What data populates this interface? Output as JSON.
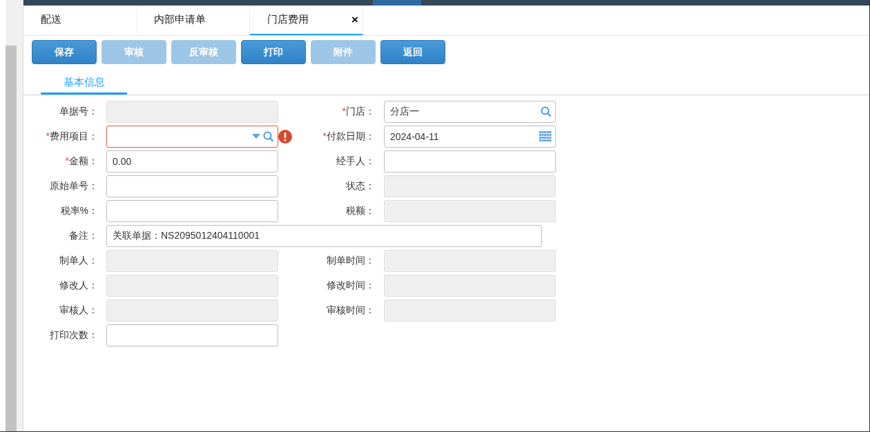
{
  "tabs": [
    {
      "label": "配送",
      "selected": false
    },
    {
      "label": "内部申请单",
      "selected": false
    },
    {
      "label": "门店费用",
      "selected": true,
      "close": "×"
    }
  ],
  "toolbar": [
    {
      "label": "保存",
      "disabled": false
    },
    {
      "label": "审核",
      "disabled": true
    },
    {
      "label": "反审核",
      "disabled": true
    },
    {
      "label": "打印",
      "disabled": false
    },
    {
      "label": "附件",
      "disabled": true
    },
    {
      "label": "返回",
      "disabled": false
    }
  ],
  "section_tabs": [
    {
      "label": "基本信息",
      "selected": true
    }
  ],
  "form_rows": [
    {
      "fields": [
        {
          "label": "单据号：",
          "kind": "text",
          "disabled": true
        },
        {
          "label": "门店：",
          "required": "*",
          "kind": "lookup",
          "disabled": false,
          "value": "分店一"
        }
      ]
    },
    {
      "fields": [
        {
          "label": "费用项目：",
          "required": "*",
          "kind": "combo",
          "disabled": false,
          "invalid": true
        },
        {
          "label": "付款日期：",
          "required": "*",
          "kind": "date",
          "disabled": false,
          "value": "2024-04-11"
        }
      ]
    },
    {
      "fields": [
        {
          "label": "金额：",
          "required": "*",
          "kind": "text",
          "disabled": false,
          "value": "0.00"
        },
        {
          "label": "经手人：",
          "kind": "text",
          "disabled": false
        }
      ]
    },
    {
      "fields": [
        {
          "label": "原始单号：",
          "kind": "text",
          "disabled": false
        },
        {
          "label": "状态：",
          "kind": "text",
          "disabled": true
        }
      ]
    },
    {
      "fields": [
        {
          "label": "税率%：",
          "kind": "text",
          "disabled": false
        },
        {
          "label": "税额：",
          "kind": "text",
          "disabled": true
        }
      ]
    },
    {
      "fields": [
        {
          "label": "备注：",
          "kind": "wide",
          "disabled": false,
          "value": "关联单据：NS2095012404110001"
        }
      ]
    },
    {
      "fields": [
        {
          "label": "制单人：",
          "kind": "text",
          "disabled": true
        },
        {
          "label": "制单时间：",
          "kind": "text",
          "disabled": true
        }
      ]
    },
    {
      "fields": [
        {
          "label": "修改人：",
          "kind": "text",
          "disabled": true
        },
        {
          "label": "修改时间：",
          "kind": "text",
          "disabled": true
        }
      ]
    },
    {
      "fields": [
        {
          "label": "审核人：",
          "kind": "text",
          "disabled": true
        },
        {
          "label": "审核时间：",
          "kind": "text",
          "disabled": true
        }
      ]
    },
    {
      "fields": [
        {
          "label": "打印次数：",
          "kind": "text",
          "disabled": false
        }
      ]
    }
  ]
}
